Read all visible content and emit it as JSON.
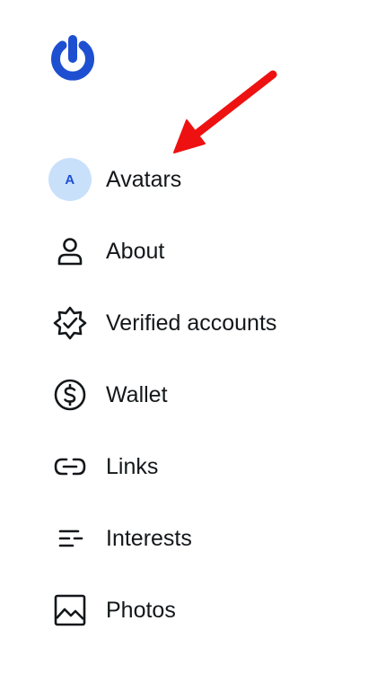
{
  "brand": {
    "logo_icon": "power-logo-icon",
    "color": "#1e4fd1"
  },
  "nav": {
    "items": [
      {
        "label": "Avatars",
        "icon": "avatar-initial",
        "avatar_initial": "A"
      },
      {
        "label": "About",
        "icon": "person-icon"
      },
      {
        "label": "Verified accounts",
        "icon": "verified-badge-icon"
      },
      {
        "label": "Wallet",
        "icon": "dollar-coin-icon"
      },
      {
        "label": "Links",
        "icon": "link-icon"
      },
      {
        "label": "Interests",
        "icon": "list-lines-icon"
      },
      {
        "label": "Photos",
        "icon": "image-icon"
      }
    ]
  },
  "annotation": {
    "arrow_color": "#ee1111",
    "points_to": "Avatars"
  },
  "colors": {
    "text": "#14171a",
    "avatar_bg": "#c9e0fb",
    "avatar_text": "#1d4fd6"
  }
}
